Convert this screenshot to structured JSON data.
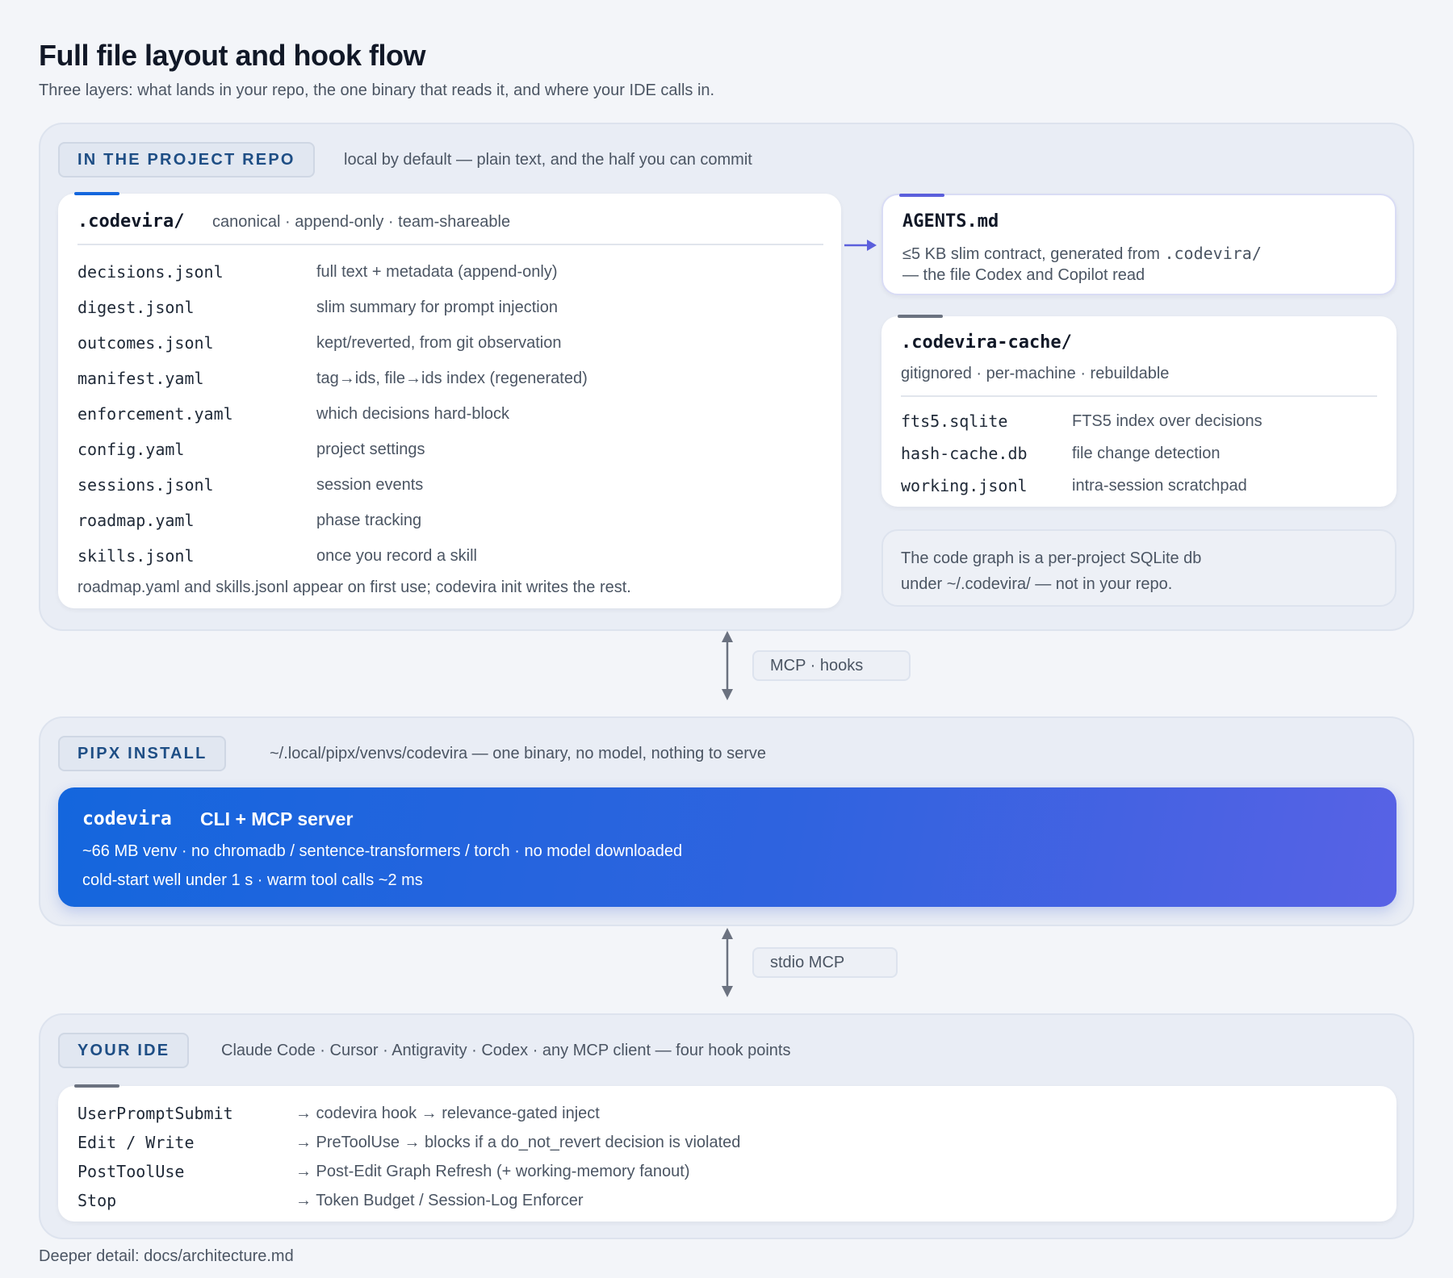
{
  "title": "Full file layout and hook flow",
  "subtitle": "Three layers: what lands in your repo, the one binary that reads it, and where your IDE calls in.",
  "colors": {
    "repo_accent": "#1466dd",
    "agents_accent": "#5b5fdc",
    "cache_accent": "#6b7280",
    "ide_accent": "#6b7280",
    "binary_gradient_start": "#1466dd",
    "binary_gradient_end": "#5862e5",
    "arrow": "#5b5fdc",
    "connector": "#6b7280"
  },
  "repo_layer": {
    "label": "IN THE PROJECT REPO",
    "description": "local by default — plain text, and the half you can commit",
    "codevira_card": {
      "title": ".codevira/",
      "subtitle": "canonical · append-only · team-shareable",
      "files": [
        {
          "name": "decisions.jsonl",
          "desc": "full text + metadata (append-only)"
        },
        {
          "name": "digest.jsonl",
          "desc": "slim summary for prompt injection"
        },
        {
          "name": "outcomes.jsonl",
          "desc": "kept/reverted, from git observation"
        },
        {
          "name": "manifest.yaml",
          "desc": "tag→ids, file→ids index (regenerated)"
        },
        {
          "name": "enforcement.yaml",
          "desc": "which decisions hard-block"
        },
        {
          "name": "config.yaml",
          "desc": "project settings"
        },
        {
          "name": "sessions.jsonl",
          "desc": "session events"
        },
        {
          "name": "roadmap.yaml",
          "desc": "phase tracking"
        },
        {
          "name": "skills.jsonl",
          "desc": "once you record a skill"
        }
      ],
      "note": "roadmap.yaml and skills.jsonl appear on first use; codevira init writes the rest."
    },
    "agents_card": {
      "title": "AGENTS.md",
      "line1_prefix": "≤5 KB slim contract, generated from ",
      "line1_code": ".codevira/",
      "line2": "— the file Codex and Copilot read"
    },
    "cache_card": {
      "title": ".codevira-cache/",
      "subtitle": "gitignored · per-machine · rebuildable",
      "files": [
        {
          "name": "fts5.sqlite",
          "desc": "FTS5 index over decisions"
        },
        {
          "name": "hash-cache.db",
          "desc": "file change detection"
        },
        {
          "name": "working.jsonl",
          "desc": "intra-session scratchpad"
        }
      ]
    },
    "graph_note": {
      "line1": "The code graph is a per-project SQLite db",
      "line2": "under ~/.codevira/ — not in your repo."
    }
  },
  "edge_repo_pipx": {
    "label": "MCP · hooks"
  },
  "pipx_layer": {
    "label": "PIPX INSTALL",
    "description": "~/.local/pipx/venvs/codevira — one binary, no model, nothing to serve",
    "binary": {
      "name": "codevira",
      "role": "CLI + MCP server",
      "line1": "~66 MB venv · no chromadb / sentence-transformers / torch · no model downloaded",
      "line2": "cold-start well under 1 s · warm tool calls ~2 ms"
    }
  },
  "edge_pipx_ide": {
    "label": "stdio MCP"
  },
  "ide_layer": {
    "label": "YOUR IDE",
    "description": "Claude Code · Cursor · Antigravity · Codex · any MCP client — four hook points",
    "hooks": [
      {
        "name": "UserPromptSubmit",
        "desc": "→ codevira hook → relevance-gated inject"
      },
      {
        "name": "Edit / Write",
        "desc": "→ PreToolUse → blocks if a do_not_revert decision is violated"
      },
      {
        "name": "PostToolUse",
        "desc": "→ Post-Edit Graph Refresh (+ working-memory fanout)"
      },
      {
        "name": "Stop",
        "desc": "→ Token Budget / Session-Log Enforcer"
      }
    ]
  },
  "footer": "Deeper detail: docs/architecture.md"
}
